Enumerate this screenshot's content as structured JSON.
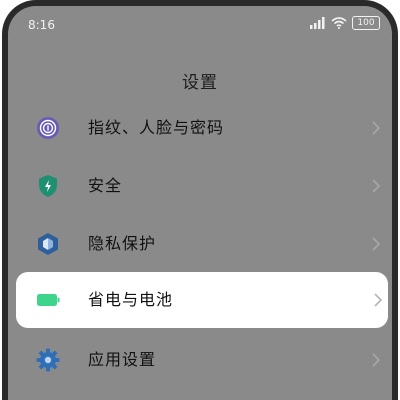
{
  "status_bar": {
    "time": "8:16",
    "battery": "100",
    "icons": [
      "signal-icon",
      "wifi-icon",
      "battery-icon"
    ]
  },
  "page": {
    "title": "设置"
  },
  "items": [
    {
      "label": "指纹、人脸与密码",
      "icon": "fingerprint-icon",
      "highlighted": false
    },
    {
      "label": "安全",
      "icon": "shield-icon",
      "highlighted": false
    },
    {
      "label": "隐私保护",
      "icon": "privacy-icon",
      "highlighted": false
    },
    {
      "label": "省电与电池",
      "icon": "battery-icon",
      "highlighted": true
    },
    {
      "label": "应用设置",
      "icon": "gear-icon",
      "highlighted": false
    }
  ],
  "colors": {
    "overlay": "#8a8a8a",
    "highlight_bg": "#ffffff",
    "fingerprint": "#6a5ab8",
    "shield": "#1f8f72",
    "privacy": "#2e5f9a",
    "battery": "#3fd48c",
    "gear": "#2f6fb8"
  }
}
